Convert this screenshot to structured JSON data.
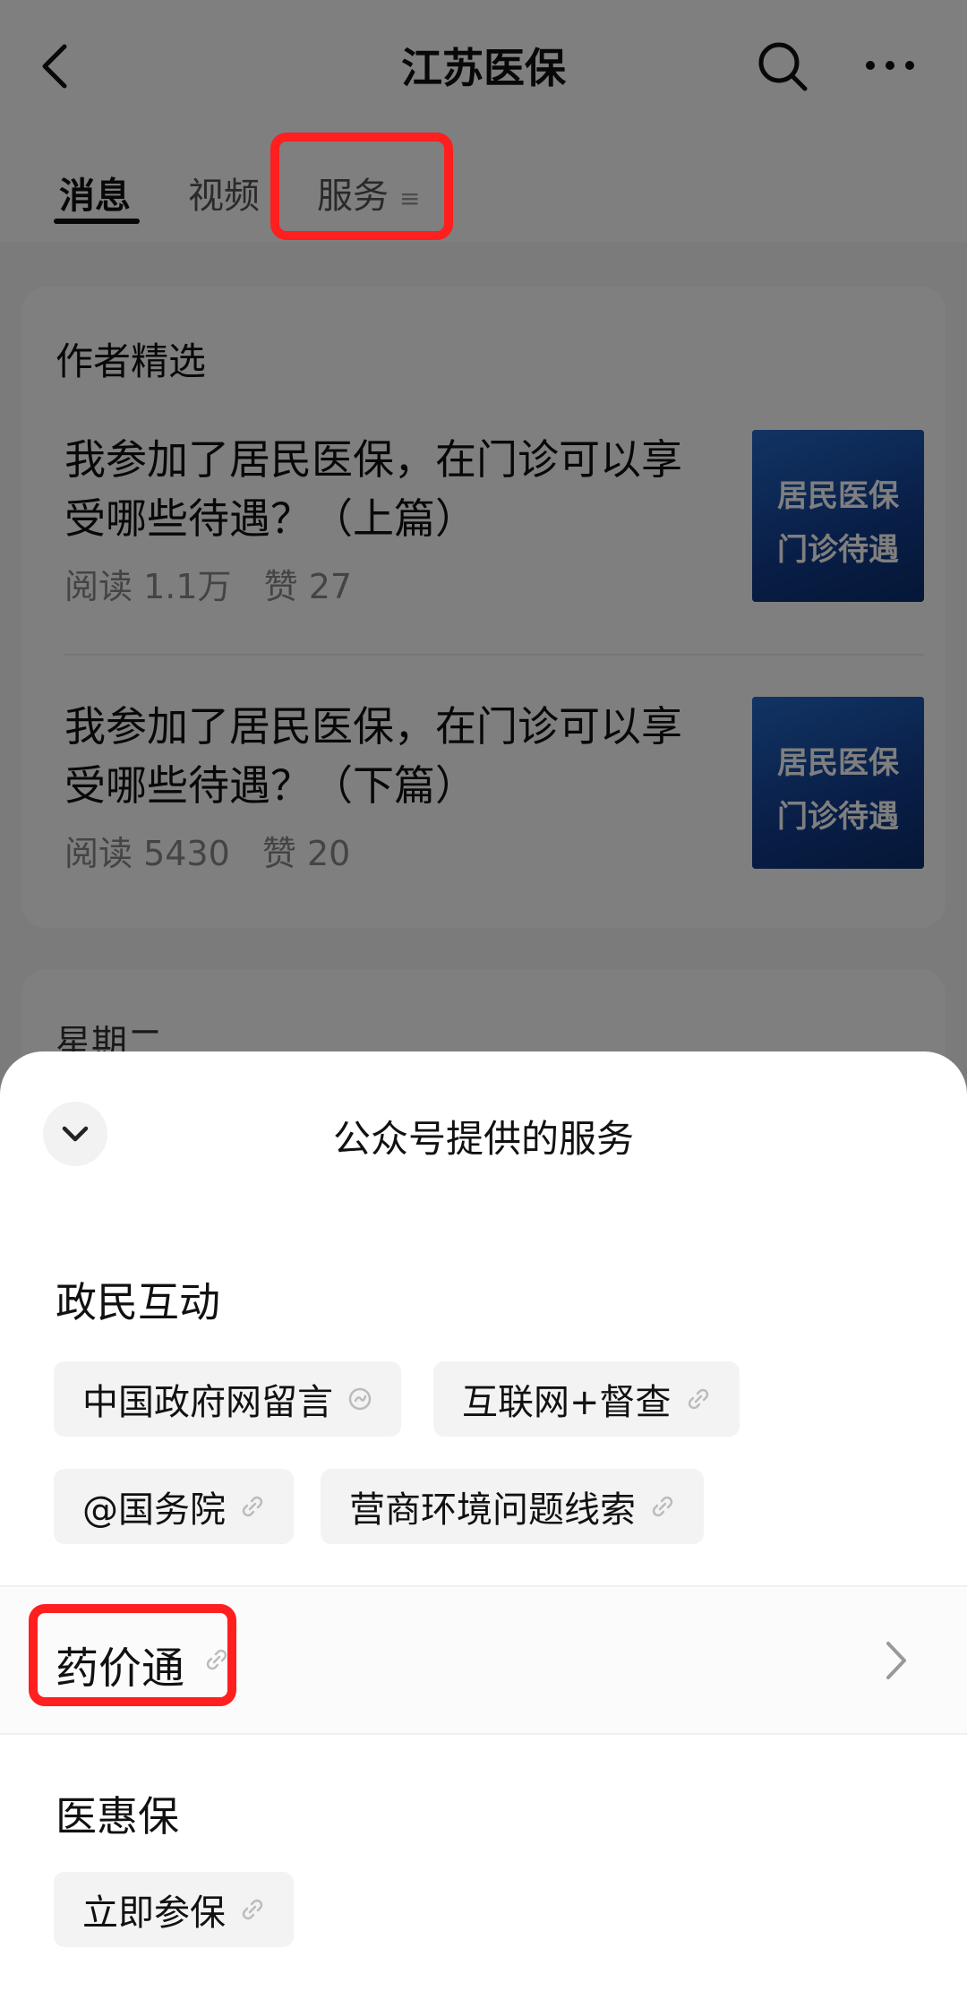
{
  "header": {
    "title": "江苏医保"
  },
  "tabs": [
    {
      "label": "消息"
    },
    {
      "label": "视频"
    },
    {
      "label": "服务"
    }
  ],
  "author_pick": {
    "title": "作者精选",
    "articles": [
      {
        "title": "我参加了居民医保，在门诊可以享受哪些待遇？（上篇）",
        "reads": "阅读 1.1万",
        "likes": "赞 27",
        "thumb_text": [
          "居民医保",
          "门诊待遇"
        ]
      },
      {
        "title": "我参加了居民医保，在门诊可以享受哪些待遇？（下篇）",
        "reads": "阅读 5430",
        "likes": "赞 20",
        "thumb_text": [
          "居民医保",
          "门诊待遇"
        ]
      }
    ]
  },
  "next_card": {
    "title": "星期二"
  },
  "sheet": {
    "title": "公众号提供的服务",
    "sections": [
      {
        "title": "政民互动",
        "chips": [
          "中国政府网留言",
          "互联网+督查",
          "@国务院",
          "营商环境问题线索"
        ]
      },
      {
        "title": "药价通"
      },
      {
        "title": "医惠保",
        "chips": [
          "立即参保"
        ]
      }
    ]
  },
  "colors": {
    "highlight": "#ff1f1f",
    "thumb_blue": "#123d8e"
  }
}
